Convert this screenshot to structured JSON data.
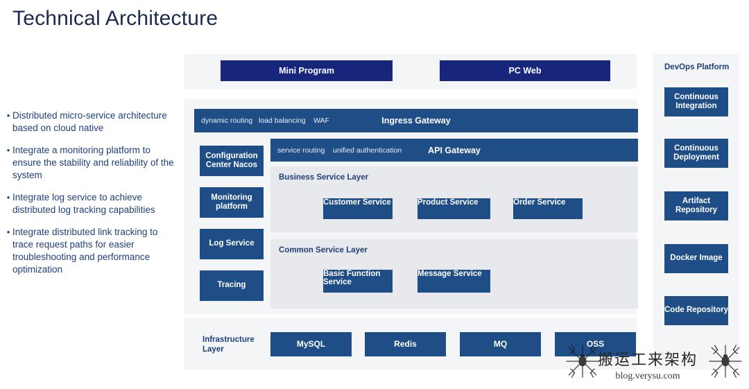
{
  "title": "Technical Architecture",
  "bullets": [
    "Distributed micro-service architecture based on cloud native",
    "Integrate a monitoring platform to ensure the stability and reliability of the system",
    "Integrate log service to achieve distributed log tracking capabilities",
    "Integrate distributed link tracking to trace request paths for easier troubleshooting and performance optimization"
  ],
  "clients": [
    {
      "label": "Mini Program"
    },
    {
      "label": "PC Web"
    }
  ],
  "ingress": {
    "title": "Ingress Gateway",
    "tags": [
      "dynamic routing",
      "load balancing",
      "WAF"
    ]
  },
  "api_gateway": {
    "title": "API Gateway",
    "tags": [
      "service routing",
      "unified authentication"
    ]
  },
  "left_stack": [
    {
      "label": "Configuration Center Nacos"
    },
    {
      "label": "Monitoring platform"
    },
    {
      "label": "Log Service"
    },
    {
      "label": "Tracing"
    }
  ],
  "business_layer": {
    "label": "Business Service Layer",
    "services": [
      {
        "label": "Customer Service"
      },
      {
        "label": "Product Service"
      },
      {
        "label": "Order Service"
      }
    ]
  },
  "common_layer": {
    "label": "Common Service Layer",
    "services": [
      {
        "label": "Basic Function Service"
      },
      {
        "label": "Message Service"
      }
    ]
  },
  "infrastructure": {
    "label": "Infrastructure Layer",
    "items": [
      {
        "label": "MySQL"
      },
      {
        "label": "Redis"
      },
      {
        "label": "MQ"
      },
      {
        "label": "OSS"
      }
    ]
  },
  "devops": {
    "title": "DevOps Platform",
    "items": [
      {
        "label": "Continuous Integration"
      },
      {
        "label": "Continuous Deployment"
      },
      {
        "label": "Artifact Repository"
      },
      {
        "label": "Docker Image"
      },
      {
        "label": "Code Repository"
      }
    ]
  },
  "watermark": {
    "main": "搬运工来架构",
    "sub": "blog.verysu.com"
  },
  "colors": {
    "dark_navy": "#17267c",
    "blue": "#1f4e87",
    "band": "#f4f5f7",
    "panel": "#e7e9ec",
    "text_blue": "#1f3f7a"
  }
}
